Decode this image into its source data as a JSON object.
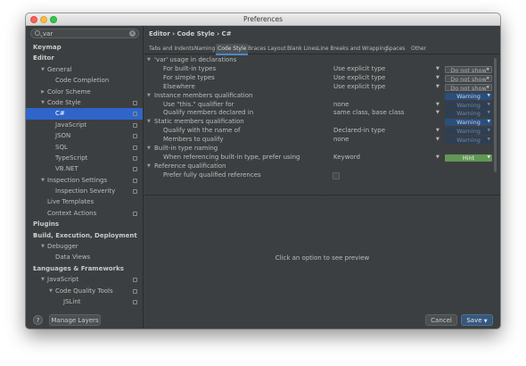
{
  "window": {
    "title": "Preferences"
  },
  "search": {
    "value": "var",
    "placeholder": ""
  },
  "sidebar": {
    "items": [
      {
        "label": "Keymap",
        "depth": 0,
        "bold": true,
        "arrow": "",
        "icon": false,
        "selected": false
      },
      {
        "label": "Editor",
        "depth": 0,
        "bold": true,
        "arrow": "▼",
        "icon": false,
        "selected": false
      },
      {
        "label": "General",
        "depth": 1,
        "bold": false,
        "arrow": "▼",
        "icon": false,
        "selected": false
      },
      {
        "label": "Code Completion",
        "depth": 2,
        "bold": false,
        "arrow": "",
        "icon": false,
        "selected": false
      },
      {
        "label": "Color Scheme",
        "depth": 1,
        "bold": false,
        "arrow": "▶",
        "icon": false,
        "selected": false
      },
      {
        "label": "Code Style",
        "depth": 1,
        "bold": false,
        "arrow": "▼",
        "icon": true,
        "selected": false
      },
      {
        "label": "C#",
        "depth": 2,
        "bold": false,
        "arrow": "",
        "icon": true,
        "selected": true
      },
      {
        "label": "JavaScript",
        "depth": 2,
        "bold": false,
        "arrow": "",
        "icon": true,
        "selected": false
      },
      {
        "label": "JSON",
        "depth": 2,
        "bold": false,
        "arrow": "",
        "icon": true,
        "selected": false
      },
      {
        "label": "SQL",
        "depth": 2,
        "bold": false,
        "arrow": "",
        "icon": true,
        "selected": false
      },
      {
        "label": "TypeScript",
        "depth": 2,
        "bold": false,
        "arrow": "",
        "icon": true,
        "selected": false
      },
      {
        "label": "VB.NET",
        "depth": 2,
        "bold": false,
        "arrow": "",
        "icon": true,
        "selected": false
      },
      {
        "label": "Inspection Settings",
        "depth": 1,
        "bold": false,
        "arrow": "▼",
        "icon": true,
        "selected": false
      },
      {
        "label": "Inspection Severity",
        "depth": 2,
        "bold": false,
        "arrow": "",
        "icon": true,
        "selected": false
      },
      {
        "label": "Live Templates",
        "depth": 1,
        "bold": false,
        "arrow": "",
        "icon": false,
        "selected": false
      },
      {
        "label": "Context Actions",
        "depth": 1,
        "bold": false,
        "arrow": "",
        "icon": true,
        "selected": false
      },
      {
        "label": "Plugins",
        "depth": 0,
        "bold": true,
        "arrow": "",
        "icon": false,
        "selected": false
      },
      {
        "label": "Build, Execution, Deployment",
        "depth": 0,
        "bold": true,
        "arrow": "▼",
        "icon": false,
        "selected": false
      },
      {
        "label": "Debugger",
        "depth": 1,
        "bold": false,
        "arrow": "▼",
        "icon": false,
        "selected": false
      },
      {
        "label": "Data Views",
        "depth": 2,
        "bold": false,
        "arrow": "",
        "icon": false,
        "selected": false
      },
      {
        "label": "Languages & Frameworks",
        "depth": 0,
        "bold": true,
        "arrow": "▼",
        "icon": false,
        "selected": false
      },
      {
        "label": "JavaScript",
        "depth": 1,
        "bold": false,
        "arrow": "▼",
        "icon": true,
        "selected": false
      },
      {
        "label": "Code Quality Tools",
        "depth": 2,
        "bold": false,
        "arrow": "▼",
        "icon": true,
        "selected": false
      },
      {
        "label": "JSLint",
        "depth": 3,
        "bold": false,
        "arrow": "",
        "icon": true,
        "selected": false
      }
    ]
  },
  "breadcrumb": "Editor  ›  Code Style  ›  C#",
  "tabs": [
    {
      "label": "Tabs and Indents",
      "active": false
    },
    {
      "label": "Naming",
      "active": false
    },
    {
      "label": "Code Style",
      "active": true
    },
    {
      "label": "Braces Layout",
      "active": false
    },
    {
      "label": "Blank Lines",
      "active": false
    },
    {
      "label": "Line Breaks and Wrapping",
      "active": false
    },
    {
      "label": "Spaces",
      "active": false
    },
    {
      "label": "Other",
      "active": false
    }
  ],
  "options": [
    {
      "label": "'var' usage in declarations",
      "group": true,
      "indent": 0,
      "value": "",
      "severity": "",
      "sev_style": ""
    },
    {
      "label": "For built-in types",
      "group": false,
      "indent": 1,
      "value": "Use explicit type",
      "severity": "Do not show",
      "sev_style": "dns"
    },
    {
      "label": "For simple types",
      "group": false,
      "indent": 1,
      "value": "Use explicit type",
      "severity": "Do not show",
      "sev_style": "dns"
    },
    {
      "label": "Elsewhere",
      "group": false,
      "indent": 1,
      "value": "Use explicit type",
      "severity": "Do not show",
      "sev_style": "dns"
    },
    {
      "label": "Instance members qualification",
      "group": true,
      "indent": 0,
      "value": "",
      "severity": "Warning",
      "sev_style": "warn"
    },
    {
      "label": "Use \"this.\" qualifier for",
      "group": false,
      "indent": 1,
      "value": "none",
      "severity": "Warning",
      "sev_style": "warn-dim"
    },
    {
      "label": "Qualify members declared in",
      "group": false,
      "indent": 1,
      "value": "same class, base class",
      "severity": "Warning",
      "sev_style": "warn-dim"
    },
    {
      "label": "Static members qualification",
      "group": true,
      "indent": 0,
      "value": "",
      "severity": "Warning",
      "sev_style": "warn"
    },
    {
      "label": "Qualify with the name of",
      "group": false,
      "indent": 1,
      "value": "Declared-in type",
      "severity": "Warning",
      "sev_style": "warn-dim"
    },
    {
      "label": "Members to qualify",
      "group": false,
      "indent": 1,
      "value": "none",
      "severity": "Warning",
      "sev_style": "warn-dim"
    },
    {
      "label": "Built-in type naming",
      "group": true,
      "indent": 0,
      "value": "",
      "severity": "",
      "sev_style": ""
    },
    {
      "label": "When referencing built-in type, prefer using",
      "group": false,
      "indent": 1,
      "value": "Keyword",
      "severity": "Hint",
      "sev_style": "hint"
    },
    {
      "label": "Reference qualification",
      "group": true,
      "indent": 0,
      "value": "",
      "severity": "",
      "sev_style": ""
    },
    {
      "label": "Prefer fully qualified references",
      "group": false,
      "indent": 1,
      "value": "",
      "checkbox": true,
      "severity": "",
      "sev_style": ""
    }
  ],
  "preview": {
    "message": "Click an option to see preview"
  },
  "buttons": {
    "manage_layers": "Manage Layers",
    "cancel": "Cancel",
    "save": "Save"
  },
  "colors": {
    "selection": "#2f65ca",
    "warning": "#2a4f7c",
    "hint": "#629755",
    "background": "#3c3f41"
  }
}
